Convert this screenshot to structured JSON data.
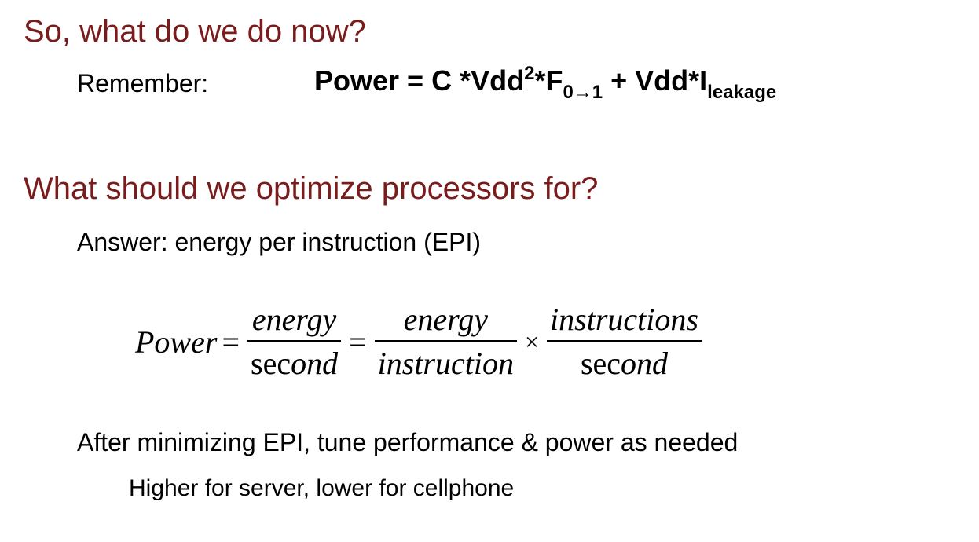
{
  "slide": {
    "heading_1": "So, what do we do now?",
    "remember_label": "Remember:",
    "formula": {
      "part_1": "Power = C *Vdd",
      "sup_1": "2",
      "part_2": "*F",
      "sub_1": "0→1",
      "part_3": " + Vdd*I",
      "sub_2": "leakage"
    },
    "heading_2": "What should we optimize processors for?",
    "answer": "Answer: energy per instruction (EPI)",
    "equation": {
      "lhs": "Power",
      "eq_sign": "=",
      "frac1_num": "energy",
      "frac1_den_upright": "sec",
      "frac1_den_italic": "ond",
      "frac2_num": "energy",
      "frac2_den": "instruction",
      "times": "×",
      "frac3_num": "instructions",
      "frac3_den_upright": "sec",
      "frac3_den_italic": "ond"
    },
    "after_text": "After minimizing EPI, tune performance & power as needed",
    "sub_text": "Higher for server, lower for cellphone",
    "colors": {
      "heading": "#7a1c1c",
      "body": "#000000",
      "background": "#ffffff"
    }
  }
}
